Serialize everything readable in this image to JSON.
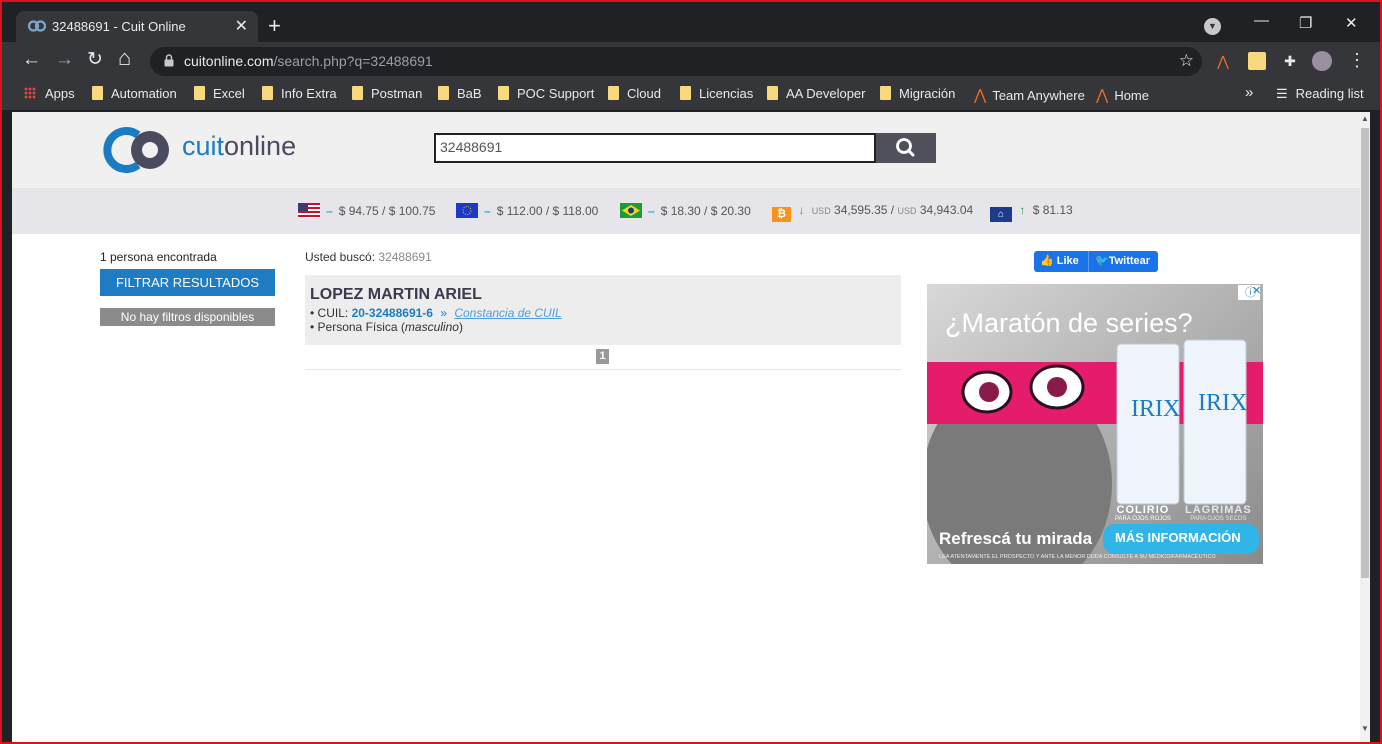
{
  "tab": {
    "title": "32488691 - Cuit Online",
    "close": "✕"
  },
  "window_controls": {
    "minimize": "—",
    "restore": "❐",
    "close": "✕"
  },
  "toolbar": {
    "back": "←",
    "forward": "→",
    "reload": "↻",
    "home": "⌂",
    "url_host": "cuitonline.com",
    "url_path": "/search.php?q=32488691",
    "star": "☆",
    "menu": "⋮"
  },
  "bookmarks": {
    "apps": "Apps",
    "items": [
      "Automation",
      "Excel",
      "Info Extra",
      "Postman",
      "BaB",
      "POC Support",
      "Cloud",
      "Licencias",
      "AA Developer",
      "Migración"
    ],
    "aa_items": [
      "Team Anywhere",
      "Home"
    ],
    "overflow": "»",
    "reading_list": "Reading list"
  },
  "site": {
    "logo_part1": "cuit",
    "logo_part2": "online",
    "search_value": "32488691",
    "rates": {
      "usd": "$ 94.75 / $ 100.75",
      "eur": "$ 112.00 / $ 118.00",
      "brl": "$ 18.30 / $ 20.30",
      "btc_prefix1": "USD",
      "btc_1": "34,595.35 /",
      "btc_prefix2": "USD",
      "btc_2": "34,943.04",
      "uva": "$ 81.13",
      "dash": "–"
    },
    "found_count": "1 persona encontrada",
    "filter_button": "FILTRAR RESULTADOS",
    "no_filters": "No hay filtros disponibles",
    "searched_label": "Usted buscó:",
    "searched_query": "32488691",
    "result": {
      "name": "LOPEZ MARTIN ARIEL",
      "cuil_label": "• CUIL:",
      "cuil_value": "20-32488691-6",
      "sep": "»",
      "constancia": "Constancia de CUIL",
      "persona_prefix": "• Persona Física (",
      "gender": "masculino",
      "persona_suffix": ")"
    },
    "page_number": "1",
    "social": {
      "like": "Like",
      "twitter": "Twittear"
    },
    "ad": {
      "headline": "¿Maratón de series?",
      "brand": "IRIX",
      "colirio": "COLIRIO",
      "colirio_sub": "PARA OJOS ROJOS",
      "lagrimas": "LÁGRIMAS",
      "lagrimas_sub": "PARA OJOS SECOS",
      "tagline": "Refrescá tu mirada",
      "cta": "MÁS INFORMACIÓN",
      "disclaimer": "LEA ATENTAMENTE EL PROSPECTO Y ANTE LA MENOR DUDA CONSULTE A SU MÉDICO/FARMACÉUTICO"
    }
  }
}
